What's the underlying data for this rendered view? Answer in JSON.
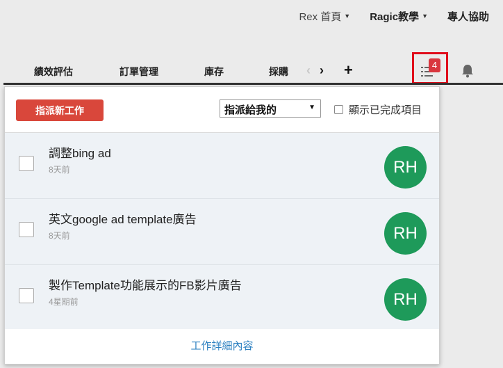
{
  "topnav": {
    "home_label": "Rex 首頁",
    "ragic_label": "Ragic教學",
    "help_label": "專人協助"
  },
  "tabs": [
    "績效評估",
    "訂單管理",
    "庫存",
    "採購"
  ],
  "tab_controls": {
    "prev": "‹",
    "next": "›",
    "add": "+"
  },
  "task_icon": {
    "name": "task-list-icon",
    "badge": "4"
  },
  "bell_icon": "bell-icon",
  "panel": {
    "assign_button": "指派新工作",
    "filter_selected": "指派給我的",
    "show_completed_label": "顯示已完成項目",
    "tasks": [
      {
        "title": "調整bing ad",
        "time": "8天前",
        "avatar": "RH"
      },
      {
        "title": "英文google ad template廣告",
        "time": "8天前",
        "avatar": "RH"
      },
      {
        "title": "製作Template功能展示的FB影片廣告",
        "time": "4星期前",
        "avatar": "RH"
      }
    ],
    "footer_link": "工作詳細內容"
  },
  "colors": {
    "assign_button": "#d9473b",
    "avatar": "#1e9a5a",
    "highlight_border": "#e00d1b",
    "badge": "#d9363e",
    "link": "#2a7fc0"
  }
}
